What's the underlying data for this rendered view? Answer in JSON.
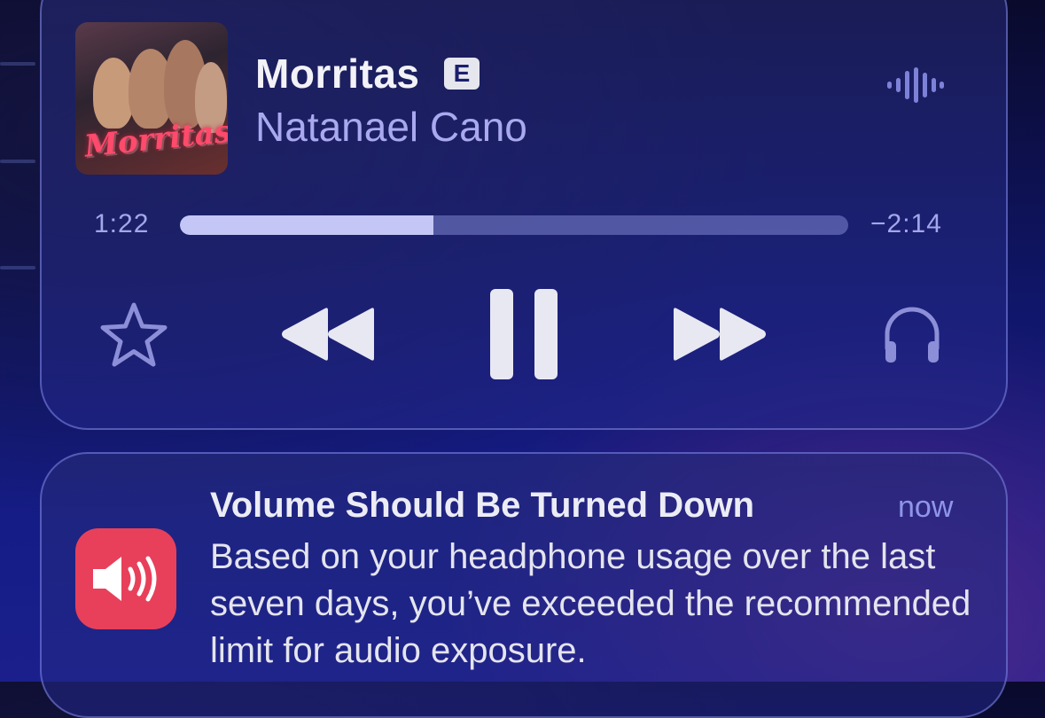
{
  "now_playing": {
    "title": "Morritas",
    "explicit_badge": "E",
    "artist": "Natanael Cano",
    "artwork_text": "Morritas",
    "elapsed": "1:22",
    "remaining": "−2:14",
    "progress": 0.379,
    "controls": {
      "favorite": "star-icon",
      "rewind": "rewind-icon",
      "pause": "pause-icon",
      "forward": "forward-icon",
      "output": "headphones-icon",
      "waveform": "waveform-icon"
    }
  },
  "notification": {
    "app_icon": "speaker-volume-icon",
    "title": "Volume Should Be Turned Down",
    "time": "now",
    "body": "Based on your headphone usage over the last seven days, you’ve exceeded the recommended limit for audio exposure."
  },
  "colors": {
    "accent_text": "#a9a9f0",
    "app_icon_bg": "#e8405a",
    "progress_fill": "#c4c6f6"
  }
}
